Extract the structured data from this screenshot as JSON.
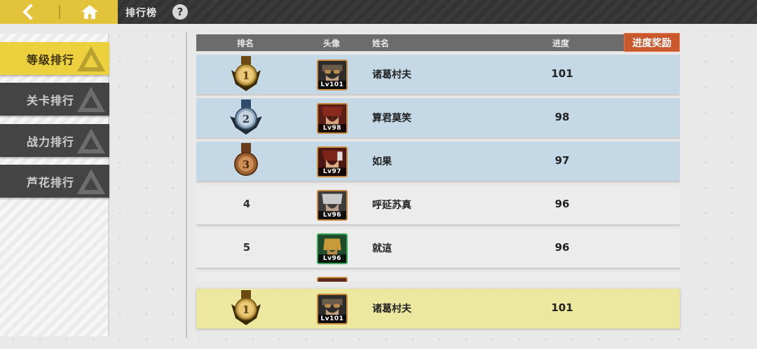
{
  "header": {
    "title": "排行榜",
    "help_label": "?",
    "back_icon": "chevron-left-icon",
    "home_icon": "home-icon"
  },
  "tabs": [
    {
      "label": "等级排行",
      "active": true
    },
    {
      "label": "关卡排行",
      "active": false
    },
    {
      "label": "战力排行",
      "active": false
    },
    {
      "label": "芦花排行",
      "active": false
    }
  ],
  "table": {
    "columns": {
      "rank": "排名",
      "avatar": "头像",
      "name": "姓名",
      "progress": "进度"
    },
    "reward_button": "进度奖励",
    "rows": [
      {
        "rank": "1",
        "medal": "gold",
        "level": "Lv101",
        "name": "诸葛村夫",
        "progress": "101"
      },
      {
        "rank": "2",
        "medal": "silver",
        "level": "Lv98",
        "name": "算君莫笑",
        "progress": "98"
      },
      {
        "rank": "3",
        "medal": "bronze",
        "level": "Lv97",
        "name": "如果",
        "progress": "97"
      },
      {
        "rank": "4",
        "medal": "",
        "level": "Lv96",
        "name": "呼延苏真",
        "progress": "96"
      },
      {
        "rank": "5",
        "medal": "",
        "level": "Lv96",
        "name": "就這",
        "progress": "96"
      }
    ]
  },
  "my_rank": {
    "rank": "1",
    "medal": "gold",
    "level": "Lv101",
    "name": "诸葛村夫",
    "progress": "101"
  },
  "colors": {
    "accent_yellow": "#e3c33a",
    "top3_row": "#c5d8e6",
    "my_row": "#ede8a0",
    "reward_orange": "#c9582c"
  }
}
